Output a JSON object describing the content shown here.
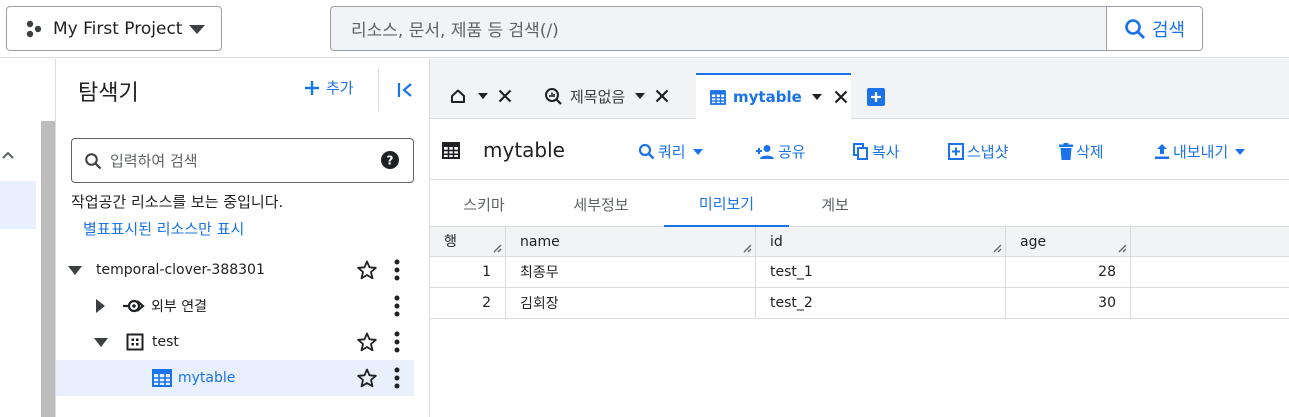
{
  "topbar": {
    "project_name": "My First Project",
    "search_placeholder": "리소스, 문서, 제품 등 검색(/)",
    "search_button": "검색"
  },
  "explorer": {
    "title": "탐색기",
    "add_label": "추가",
    "search_placeholder": "입력하여 검색",
    "workspace_text": "작업공간 리소스를 보는 중입니다.",
    "starred_link": "별표표시된 리소스만 표시",
    "tree": {
      "project": "temporal-clover-388301",
      "external": "외부 연결",
      "dataset": "test",
      "table": "mytable"
    }
  },
  "tabs": {
    "untitled": "제목없음",
    "mytable": "mytable"
  },
  "toolbar": {
    "title": "mytable",
    "query": "쿼리",
    "share": "공유",
    "copy": "복사",
    "snapshot": "스냅샷",
    "delete": "삭제",
    "export": "내보내기"
  },
  "subtabs": [
    "스키마",
    "세부정보",
    "미리보기",
    "계보"
  ],
  "active_subtab": "미리보기",
  "grid": {
    "columns": [
      "행",
      "name",
      "id",
      "age"
    ],
    "rows": [
      {
        "row": "1",
        "name": "최종무",
        "id": "test_1",
        "age": "28"
      },
      {
        "row": "2",
        "name": "김회장",
        "id": "test_2",
        "age": "30"
      }
    ]
  },
  "colors": {
    "accent": "#1a73e8",
    "selection": "#e8f0fe",
    "border": "#dadce0",
    "tabstrip": "#f1f3f4"
  }
}
